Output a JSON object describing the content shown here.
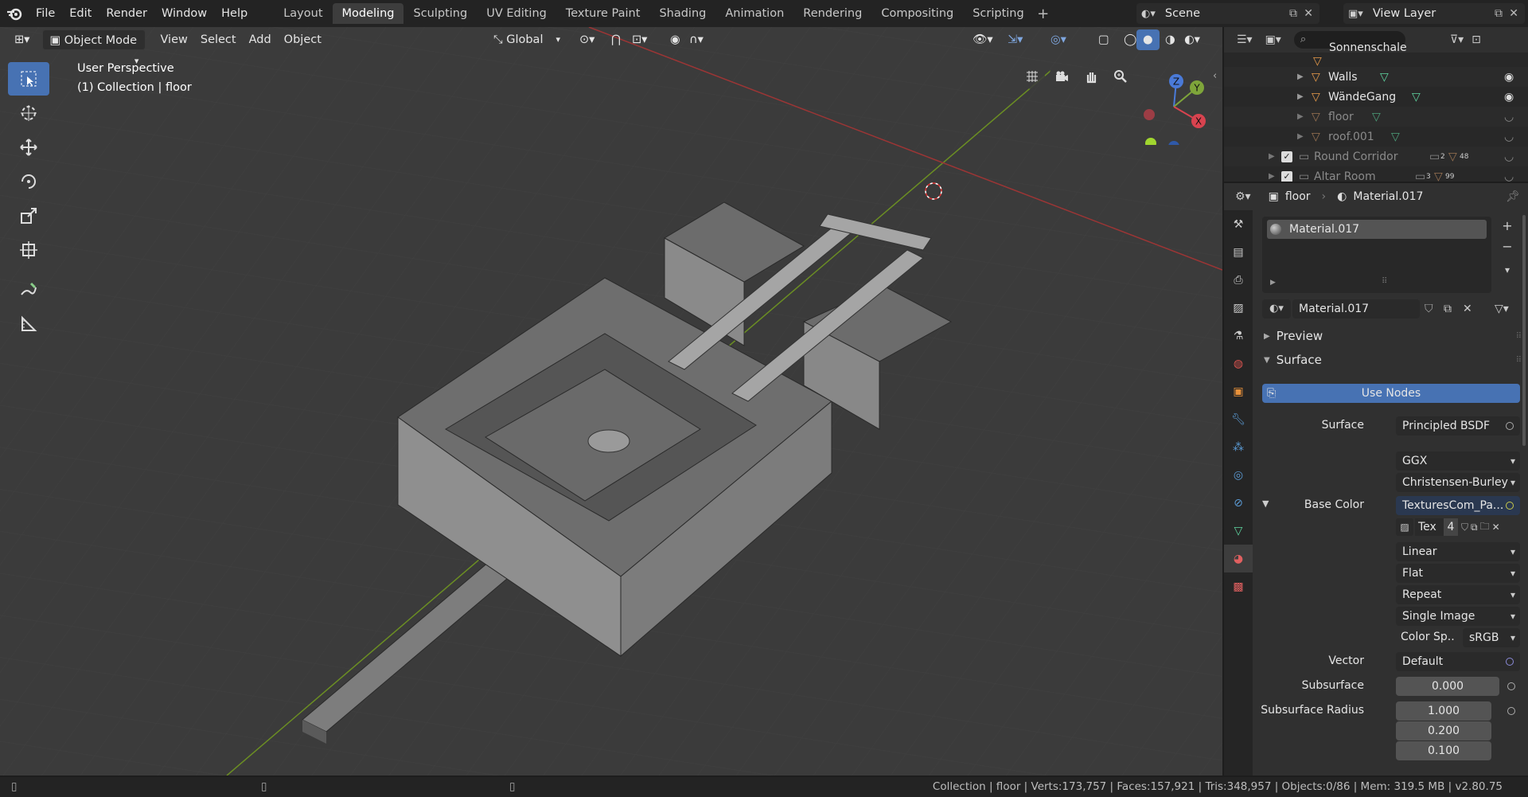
{
  "menu": {
    "items": [
      "File",
      "Edit",
      "Render",
      "Window",
      "Help"
    ]
  },
  "workspaces": {
    "tabs": [
      "Layout",
      "Modeling",
      "Sculpting",
      "UV Editing",
      "Texture Paint",
      "Shading",
      "Animation",
      "Rendering",
      "Compositing",
      "Scripting"
    ],
    "active": "Modeling"
  },
  "scene": {
    "name": "Scene"
  },
  "view_layer": {
    "name": "View Layer"
  },
  "viewport": {
    "mode": "Object Mode",
    "menus": [
      "View",
      "Select",
      "Add",
      "Object"
    ],
    "transform_orientation": "Global",
    "info_line1": "User Perspective",
    "info_line2": "(1) Collection | floor",
    "gizmo": {
      "x": "X",
      "y": "Y",
      "z": "Z"
    }
  },
  "outliner": {
    "search_placeholder": "",
    "rows": [
      {
        "name": "Sonnenschale"
      },
      {
        "name": "Walls"
      },
      {
        "name": "WändeGang"
      },
      {
        "name": "floor"
      },
      {
        "name": "roof.001"
      },
      {
        "name": "Round Corridor",
        "count_a": "2",
        "count_b": "48"
      },
      {
        "name": "Altar Room",
        "count_a": "3",
        "count_b": "99"
      }
    ]
  },
  "properties": {
    "breadcrumb_object": "floor",
    "breadcrumb_material": "Material.017",
    "slot_name": "Material.017",
    "material_name": "Material.017",
    "panels": {
      "preview": "Preview",
      "surface": "Surface"
    },
    "use_nodes": "Use Nodes",
    "surface_label": "Surface",
    "surface_value": "Principled BSDF",
    "distribution": "GGX",
    "subsurface_method": "Christensen-Burley",
    "base_color_label": "Base Color",
    "base_color_value": "TexturesCom_Pa...",
    "tex_name": "Tex",
    "tex_users": "4",
    "interpolation": "Linear",
    "projection": "Flat",
    "extension": "Repeat",
    "source": "Single Image",
    "color_space_label": "Color Sp..",
    "color_space_value": "sRGB",
    "vector_label": "Vector",
    "vector_value": "Default",
    "subsurface_label": "Subsurface",
    "subsurface_value": "0.000",
    "subsurface_radius_label": "Subsurface Radius",
    "subsurface_radius": [
      "1.000",
      "0.200",
      "0.100"
    ]
  },
  "statusbar": {
    "text": "Collection | floor | Verts:173,757 | Faces:157,921 | Tris:348,957 | Objects:0/86 | Mem: 319.5 MB | v2.80.75"
  },
  "colors": {
    "accent": "#4772b3",
    "viewport_bg": "#3b3b3b",
    "panel_bg": "#303030"
  }
}
